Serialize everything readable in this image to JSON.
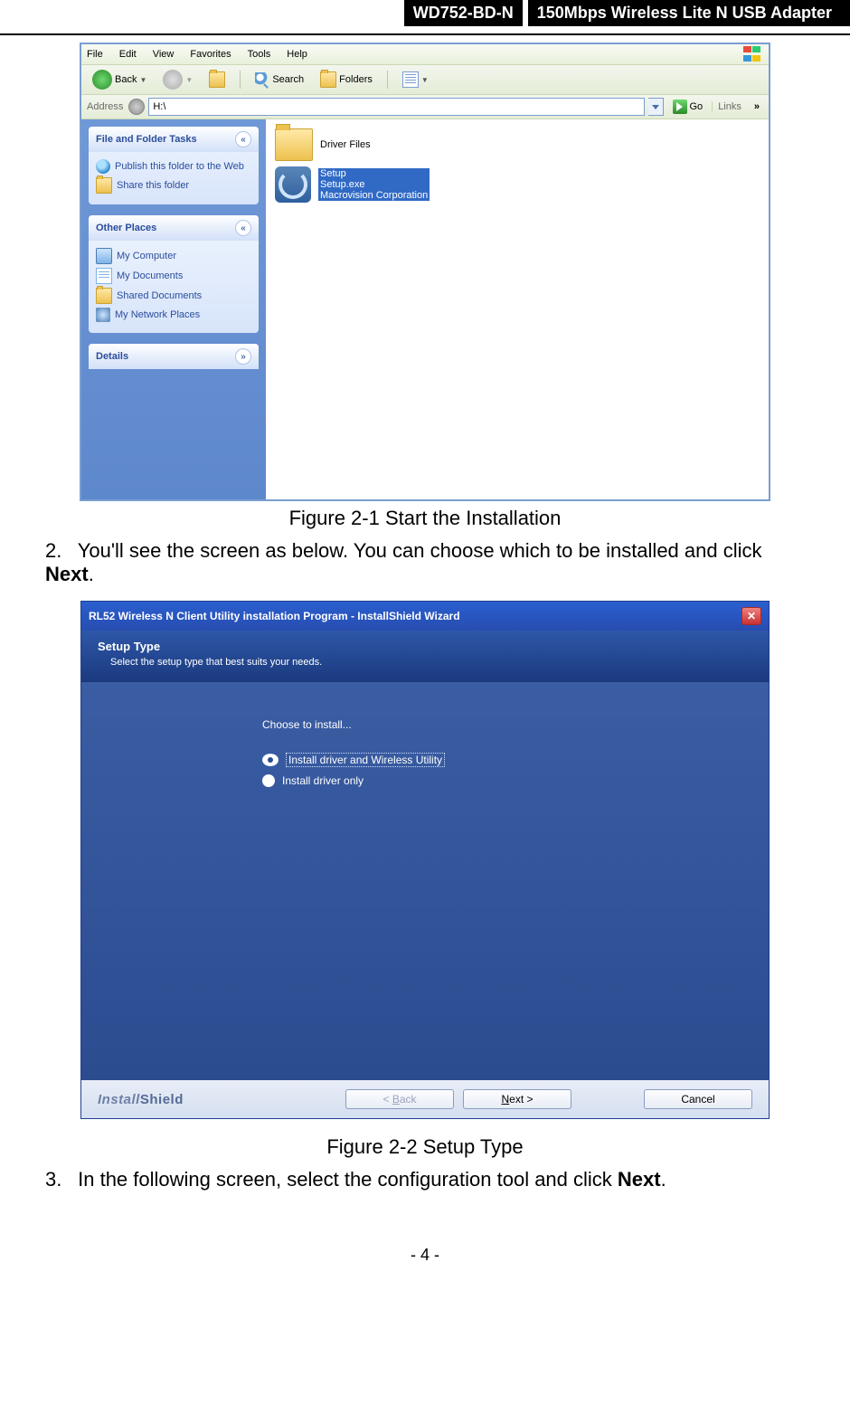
{
  "header": {
    "model": "WD752-BD-N",
    "title": "150Mbps Wireless Lite N USB Adapter"
  },
  "fig1": {
    "caption": "Figure 2-1 Start the Installation",
    "menu": {
      "file": "File",
      "edit": "Edit",
      "view": "View",
      "fav": "Favorites",
      "tools": "Tools",
      "help": "Help"
    },
    "tb": {
      "back": "Back",
      "search": "Search",
      "folders": "Folders"
    },
    "addr": {
      "label": "Address",
      "value": "H:\\",
      "go": "Go",
      "links": "Links"
    },
    "panels": {
      "tasks": {
        "title": "File and Folder Tasks",
        "items": [
          {
            "icon": "globe",
            "label": "Publish this folder to the Web"
          },
          {
            "icon": "fold",
            "label": "Share this folder"
          }
        ]
      },
      "places": {
        "title": "Other Places",
        "items": [
          {
            "icon": "pc",
            "label": "My Computer"
          },
          {
            "icon": "doc",
            "label": "My Documents"
          },
          {
            "icon": "fold",
            "label": "Shared Documents"
          },
          {
            "icon": "net",
            "label": "My Network Places"
          }
        ]
      },
      "details": {
        "title": "Details"
      }
    },
    "files": {
      "folder": "Driver Files",
      "setup": {
        "l1": "Setup",
        "l2": "Setup.exe",
        "l3": "Macrovision Corporation"
      }
    }
  },
  "step2": {
    "num": "2.",
    "text_a": "You'll see the screen as below. You can choose which to be installed and click ",
    "bold": "Next",
    "text_b": "."
  },
  "fig2": {
    "title": "RL52 Wireless N Client Utility installation Program - InstallShield Wizard",
    "head": "Setup Type",
    "sub": "Select the setup type that best suits your needs.",
    "choose": "Choose to install...",
    "opt1": "Install driver and Wireless Utility",
    "opt2": "Install driver only",
    "brand1": "Install",
    "brand2": "Shield",
    "back": "< Back",
    "back_u": "B",
    "next": "Next >",
    "next_u": "N",
    "cancel": "Cancel",
    "caption": "Figure 2-2 Setup Type"
  },
  "step3": {
    "num": "3.",
    "text_a": "In the following screen, select the configuration tool and click ",
    "bold": "Next",
    "text_b": "."
  },
  "pagenum": "- 4 -"
}
